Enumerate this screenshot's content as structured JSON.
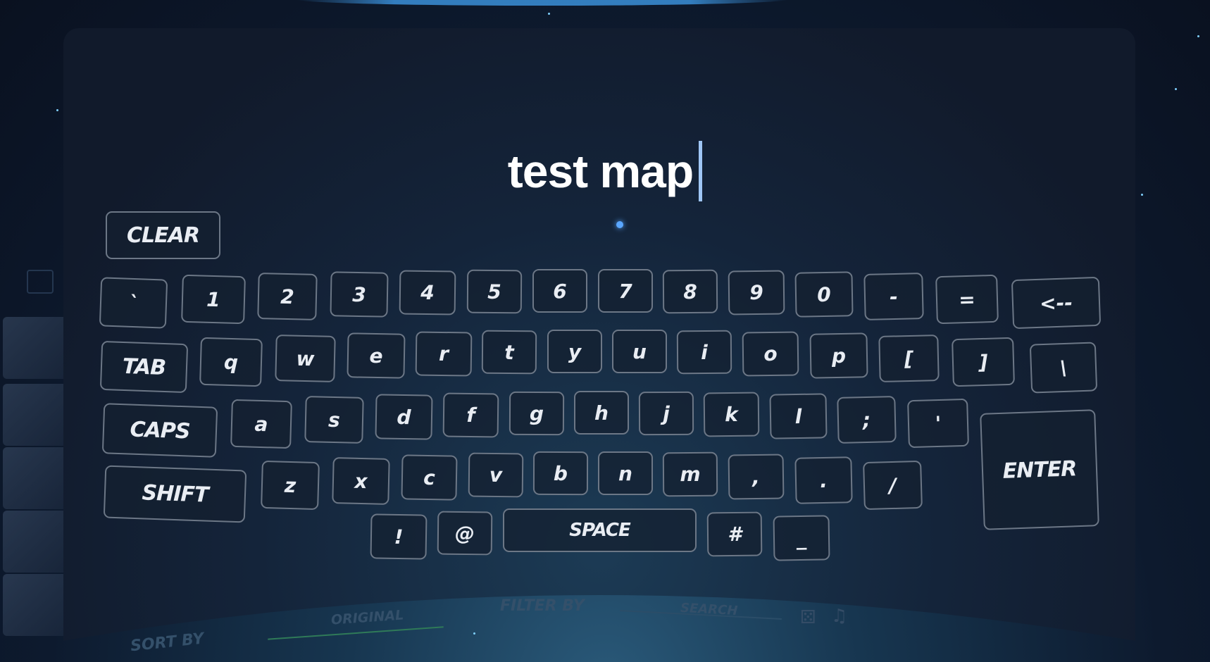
{
  "input": {
    "text": "test map"
  },
  "keyboard": {
    "clear": "CLEAR",
    "row1": [
      "`",
      "1",
      "2",
      "3",
      "4",
      "5",
      "6",
      "7",
      "8",
      "9",
      "0",
      "-",
      "=",
      "<--"
    ],
    "row2": [
      "TAB",
      "q",
      "w",
      "e",
      "r",
      "t",
      "y",
      "u",
      "i",
      "o",
      "p",
      "[",
      "]",
      "\\"
    ],
    "row3": [
      "CAPS",
      "a",
      "s",
      "d",
      "f",
      "g",
      "h",
      "j",
      "k",
      "l",
      ";",
      "'"
    ],
    "row4": [
      "SHIFT",
      "z",
      "x",
      "c",
      "v",
      "b",
      "n",
      "m",
      ",",
      ".",
      "/"
    ],
    "row5": [
      "!",
      "@",
      "SPACE",
      "#",
      "_"
    ],
    "enter": "ENTER"
  },
  "background_bar": {
    "sort_by": "SORT BY",
    "original": "ORIGINAL",
    "filter_by": "FILTER BY",
    "search": "SEARCH"
  },
  "colors": {
    "accent": "#5aa6ff",
    "text": "#ffffff",
    "key_border": "#6c7786"
  }
}
